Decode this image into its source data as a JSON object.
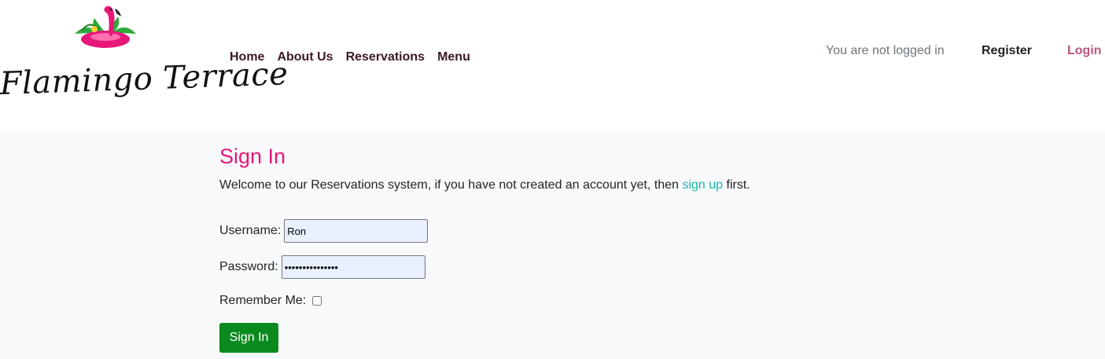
{
  "brand": {
    "name": "Flamingo Terrace",
    "logo_icon": "flamingo-float-icon",
    "colors": {
      "accent": "#e6177a",
      "link": "#17b8b0",
      "nav": "#3d1a22",
      "login": "#b8567e",
      "button": "#0b8a1f"
    }
  },
  "nav": {
    "items": [
      {
        "label": "Home"
      },
      {
        "label": "About Us"
      },
      {
        "label": "Reservations"
      },
      {
        "label": "Menu"
      }
    ]
  },
  "account": {
    "status": "You are not logged in",
    "register_label": "Register",
    "login_label": "Login"
  },
  "signin": {
    "title": "Sign In",
    "welcome_before": "Welcome to our Reservations system, if you have not created an account yet, then ",
    "signup_link": "sign up",
    "welcome_after": " first.",
    "username_label": "Username:",
    "username_value": "Ron",
    "password_label": "Password:",
    "password_value": "•••••••••••••••",
    "remember_label": "Remember Me:",
    "remember_checked": false,
    "submit_label": "Sign In"
  }
}
